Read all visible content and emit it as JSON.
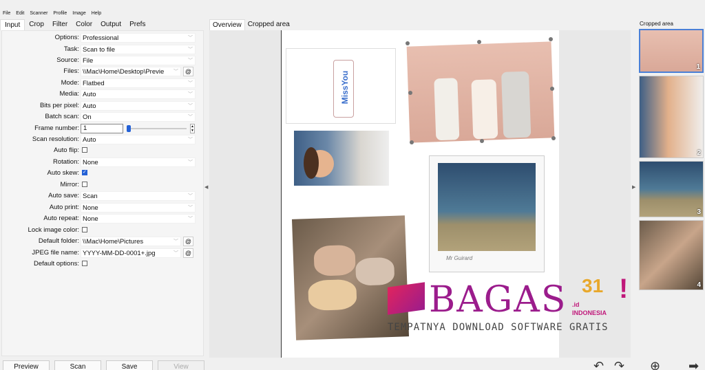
{
  "menu": [
    "File",
    "Edit",
    "Scanner",
    "Profile",
    "Image",
    "Help"
  ],
  "left_tabs": [
    "Input",
    "Crop",
    "Filter",
    "Color",
    "Output",
    "Prefs"
  ],
  "fields": {
    "options": {
      "label": "Options:",
      "value": "Professional"
    },
    "task": {
      "label": "Task:",
      "value": "Scan to file"
    },
    "source": {
      "label": "Source:",
      "value": "File"
    },
    "files": {
      "label": "Files:",
      "value": "\\\\Mac\\Home\\Desktop\\Previe"
    },
    "mode": {
      "label": "Mode:",
      "value": "Flatbed"
    },
    "media": {
      "label": "Media:",
      "value": "Auto"
    },
    "bits": {
      "label": "Bits per pixel:",
      "value": "Auto"
    },
    "batch": {
      "label": "Batch scan:",
      "value": "On"
    },
    "frame": {
      "label": "Frame number:",
      "value": "1"
    },
    "resolution": {
      "label": "Scan resolution:",
      "value": "Auto"
    },
    "autoflip": {
      "label": "Auto flip:"
    },
    "rotation": {
      "label": "Rotation:",
      "value": "None"
    },
    "autoskew": {
      "label": "Auto skew:"
    },
    "mirror": {
      "label": "Mirror:"
    },
    "autosave": {
      "label": "Auto save:",
      "value": "Scan"
    },
    "autoprint": {
      "label": "Auto print:",
      "value": "None"
    },
    "autorepeat": {
      "label": "Auto repeat:",
      "value": "None"
    },
    "lockcolor": {
      "label": "Lock image color:"
    },
    "folder": {
      "label": "Default folder:",
      "value": "\\\\Mac\\Home\\Pictures"
    },
    "jpeg": {
      "label": "JPEG file name:",
      "value": "YYYY-MM-DD-0001+.jpg"
    },
    "defaultopts": {
      "label": "Default options:"
    }
  },
  "at_symbol": "@",
  "buttons": {
    "preview": "Preview",
    "scan": "Scan",
    "save": "Save",
    "view": "View"
  },
  "center_tabs": [
    "Overview",
    "Cropped area"
  ],
  "right_title": "Cropped area",
  "thumb_numbers": [
    "1",
    "2",
    "3",
    "4"
  ],
  "photo_text": {
    "missyou": "MissYou",
    "caption": "Mr Guirard"
  },
  "watermark": {
    "brand": "BAGAS",
    "number": "31",
    "tld": ".id",
    "country": "INDONESIA",
    "tagline": "TEMPATNYA DOWNLOAD SOFTWARE GRATIS"
  }
}
